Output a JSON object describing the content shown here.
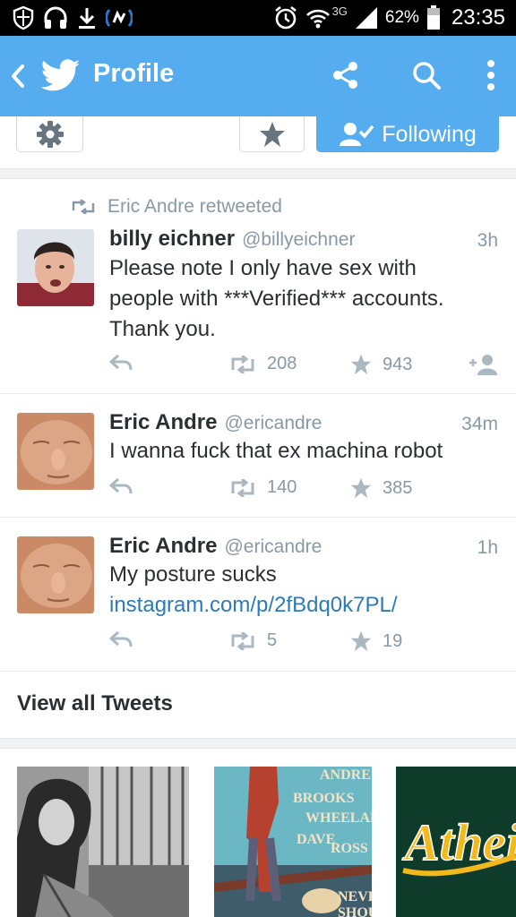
{
  "status_bar": {
    "network": "3G",
    "battery": "62%",
    "time": "23:35",
    "icons": [
      "shield-icon",
      "headphones-icon",
      "download-icon",
      "signal-app-icon",
      "alarm-icon",
      "wifi-icon",
      "cell-signal-icon",
      "battery-icon"
    ]
  },
  "app_bar": {
    "title": "Profile",
    "background": "#55acee",
    "icons": [
      "back-chevron-icon",
      "twitter-bird-icon",
      "share-icon",
      "search-icon",
      "overflow-menu-icon"
    ]
  },
  "profile_actions": {
    "following_label": "Following",
    "icons": [
      "gear-icon",
      "star-icon",
      "follow-check-icon"
    ]
  },
  "tweets": [
    {
      "retweet_label": "Eric Andre retweeted",
      "name": "billy eichner",
      "handle": "@billyeichner",
      "time": "3h",
      "text": "Please note I only have sex with people with ***Verified*** accounts. Thank you.",
      "retweets": "208",
      "favorites": "943"
    },
    {
      "name": "Eric Andre",
      "handle": "@ericandre",
      "time": "34m",
      "text": "I wanna fuck that ex machina robot",
      "retweets": "140",
      "favorites": "385"
    },
    {
      "name": "Eric Andre",
      "handle": "@ericandre",
      "time": "1h",
      "text": "My posture sucks ",
      "link": "instagram.com/p/2fBdq0k7PL/",
      "retweets": "5",
      "favorites": "19"
    }
  ],
  "view_all": {
    "label": "View all Tweets"
  },
  "colors": {
    "accent": "#55acee",
    "link": "#2b7bb9",
    "muted": "#8899a6",
    "text": "#292f33"
  }
}
